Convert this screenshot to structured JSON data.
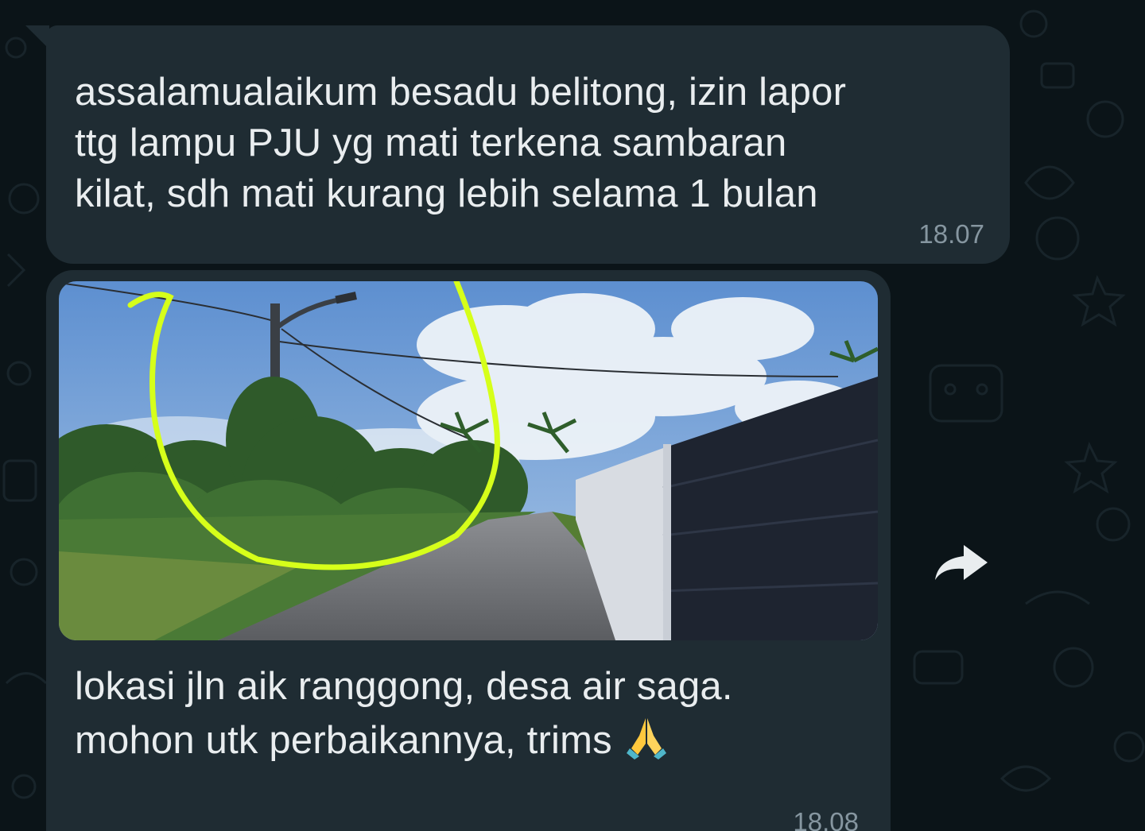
{
  "messages": [
    {
      "text": "assalamualaikum besadu belitong, izin lapor\nttg lampu PJU yg mati terkena sambaran\nkilat, sdh mati kurang lebih selama 1 bulan",
      "time": "18.07"
    },
    {
      "caption": "lokasi jln aik ranggong, desa air saga.\nmohon utk perbaikannya, trims",
      "time": "18.08",
      "image": "photo of street light pole beside road with circled area"
    }
  ],
  "icons": {
    "forward": "forward-icon",
    "emoji": "folded-hands-icon"
  },
  "colors": {
    "background": "#0b1418",
    "bubble": "#1f2c33",
    "text": "#e9edef",
    "timestamp": "#8696a0",
    "highlight": "#d6ff1a"
  }
}
